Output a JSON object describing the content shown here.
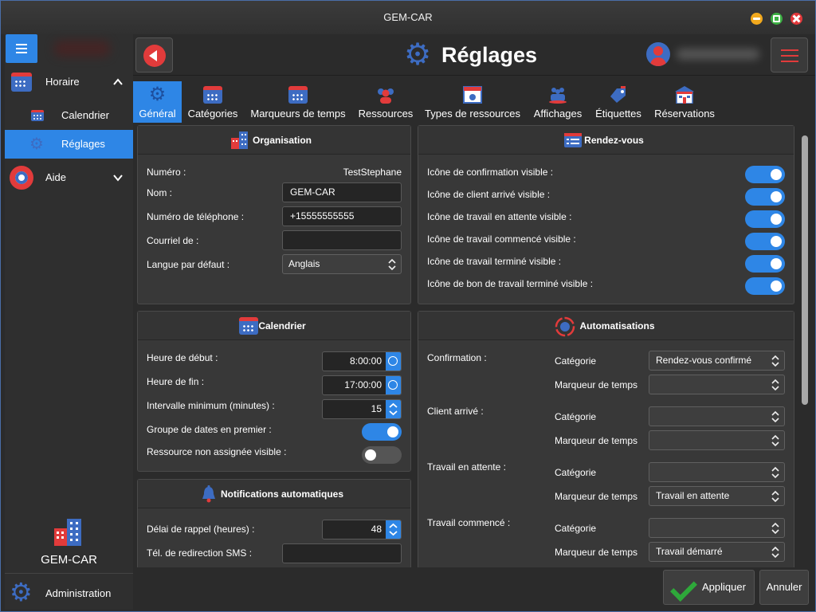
{
  "window": {
    "title": "GEM-CAR"
  },
  "sidebar": {
    "items": [
      {
        "label": "Horaire"
      },
      {
        "label": "Calendrier"
      },
      {
        "label": "Réglages"
      },
      {
        "label": "Aide"
      }
    ],
    "app_name": "GEM-CAR",
    "admin_label": "Administration"
  },
  "header": {
    "title": "Réglages"
  },
  "tabs": [
    {
      "label": "Général"
    },
    {
      "label": "Catégories"
    },
    {
      "label": "Marqueurs de temps"
    },
    {
      "label": "Ressources"
    },
    {
      "label": "Types de ressources"
    },
    {
      "label": "Affichages"
    },
    {
      "label": "Étiquettes"
    },
    {
      "label": "Réservations"
    }
  ],
  "organisation": {
    "title": "Organisation",
    "numero_label": "Numéro :",
    "numero_value": "TestStephane",
    "nom_label": "Nom :",
    "nom_value": "GEM-CAR",
    "tel_label": "Numéro de téléphone :",
    "tel_value": "+15555555555",
    "courriel_label": "Courriel de :",
    "courriel_value": "",
    "langue_label": "Langue par défaut :",
    "langue_value": "Anglais"
  },
  "rendezvous": {
    "title": "Rendez-vous",
    "items": [
      {
        "label": "Icône de confirmation visible :",
        "on": true
      },
      {
        "label": "Icône de client arrivé visible :",
        "on": true
      },
      {
        "label": "Icône de travail en attente visible :",
        "on": true
      },
      {
        "label": "Icône de travail commencé visible :",
        "on": true
      },
      {
        "label": "Icône de travail terminé visible :",
        "on": true
      },
      {
        "label": "Icône de bon de travail terminé visible :",
        "on": true
      }
    ]
  },
  "calendrier": {
    "title": "Calendrier",
    "debut_label": "Heure de début :",
    "debut_value": "8:00:00",
    "fin_label": "Heure de fin :",
    "fin_value": "17:00:00",
    "intervalle_label": "Intervalle minimum (minutes) :",
    "intervalle_value": "15",
    "groupe_label": "Groupe de dates en premier :",
    "groupe_on": true,
    "ressource_label": "Ressource non assignée visible :",
    "ressource_on": false
  },
  "notifications": {
    "title": "Notifications automatiques",
    "delai_label": "Délai de rappel (heures) :",
    "delai_value": "48",
    "sms_label": "Tél. de redirection SMS :",
    "sms_value": ""
  },
  "automatisations": {
    "title": "Automatisations",
    "categorie_label": "Catégorie",
    "marqueur_label": "Marqueur de temps",
    "groups": [
      {
        "label": "Confirmation :",
        "categorie": "Rendez-vous confirmé",
        "marqueur": ""
      },
      {
        "label": "Client arrivé :",
        "categorie": "",
        "marqueur": ""
      },
      {
        "label": "Travail en attente :",
        "categorie": "",
        "marqueur": "Travail en attente"
      },
      {
        "label": "Travail commencé :",
        "categorie": "",
        "marqueur": "Travail démarré"
      }
    ]
  },
  "footer": {
    "apply_label": "Appliquer",
    "cancel_label": "Annuler"
  },
  "colors": {
    "accent": "#2e86e6",
    "brand_red": "#e23b3b",
    "brand_blue": "#3d6cc2",
    "apply_check": "#2ea83a"
  }
}
